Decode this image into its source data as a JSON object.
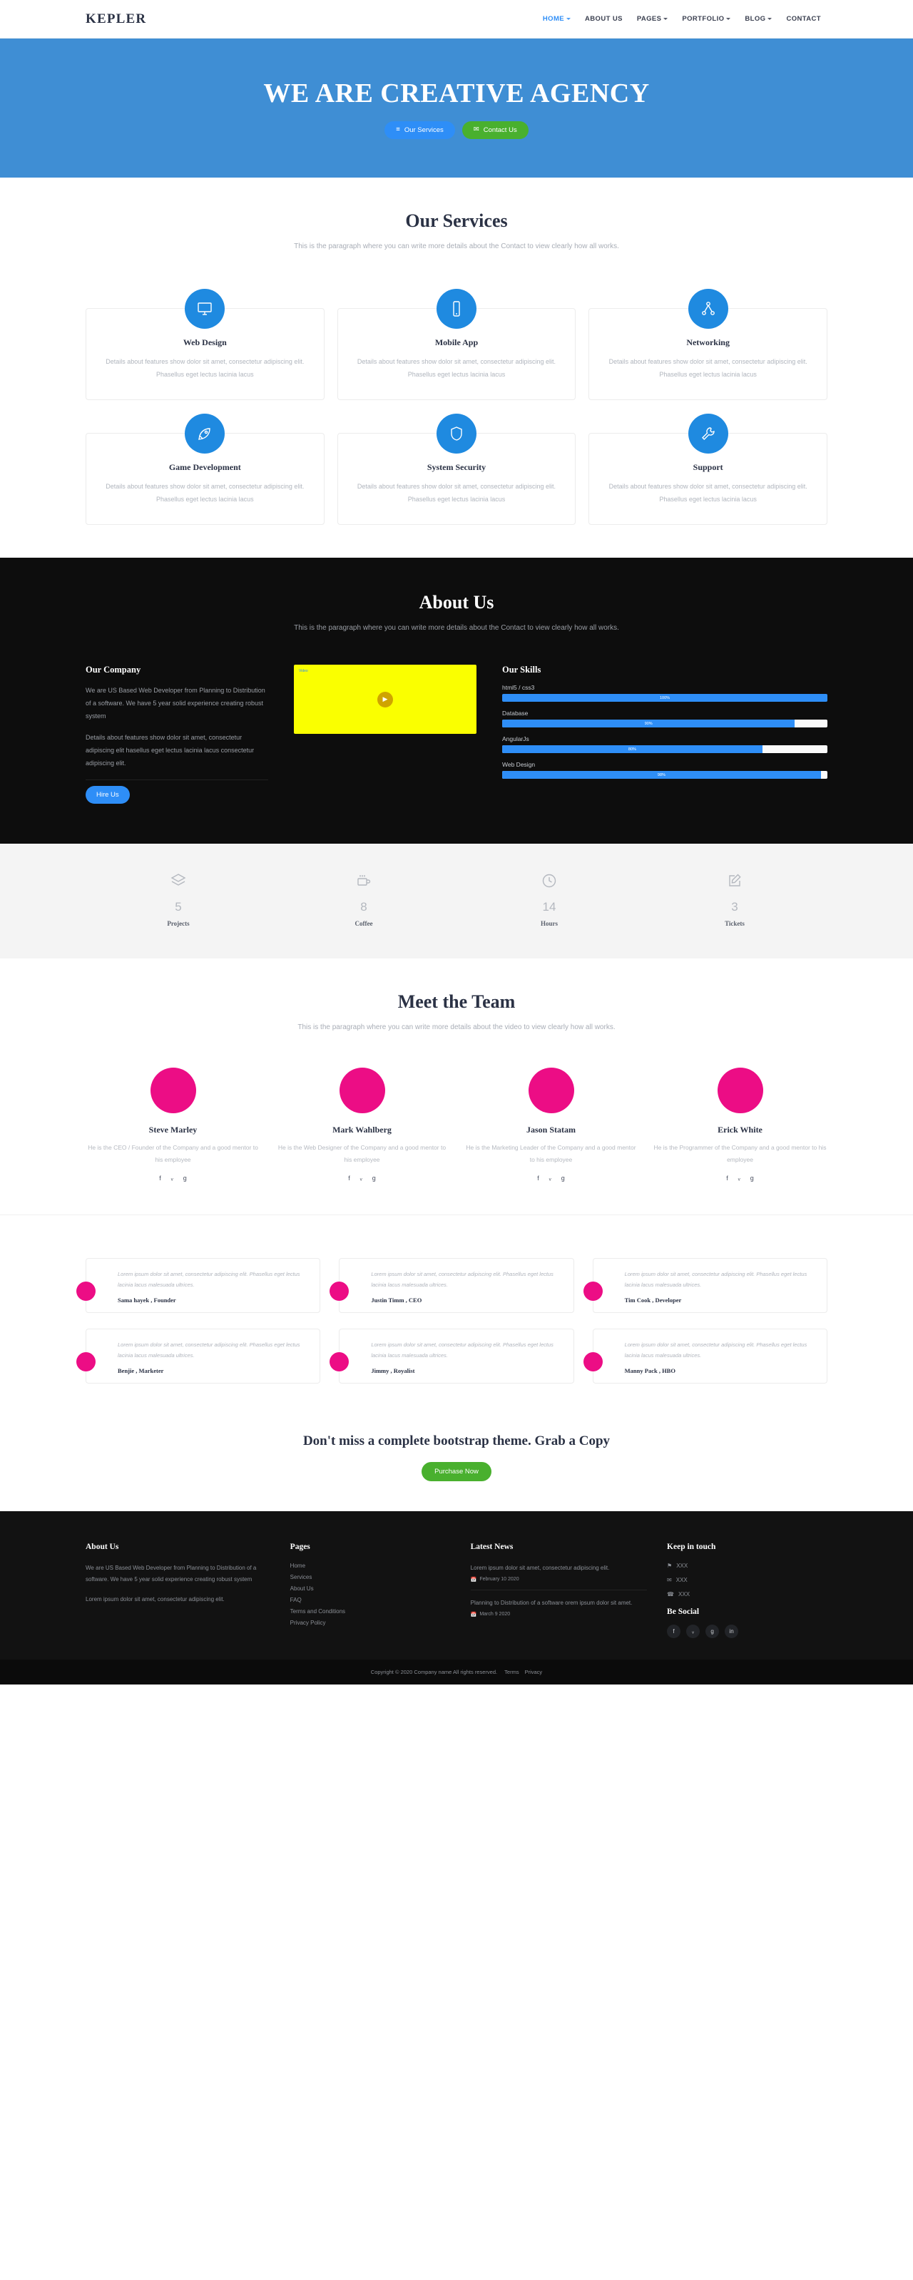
{
  "nav": {
    "brand": "KEPLER",
    "items": [
      {
        "label": "HOME",
        "caret": true,
        "active": true
      },
      {
        "label": "ABOUT US",
        "caret": false,
        "active": false
      },
      {
        "label": "PAGES",
        "caret": true,
        "active": false
      },
      {
        "label": "PORTFOLIO",
        "caret": true,
        "active": false
      },
      {
        "label": "BLOG",
        "caret": true,
        "active": false
      },
      {
        "label": "CONTACT",
        "caret": false,
        "active": false
      }
    ]
  },
  "hero": {
    "title": "WE ARE CREATIVE AGENCY",
    "bg_color": "#3f8ed4",
    "primary_button": {
      "label": "Our Services",
      "icon": "list-icon",
      "color": "#2e8ef7"
    },
    "secondary_button": {
      "label": "Contact Us",
      "icon": "envelope-icon",
      "color": "#49b02e"
    }
  },
  "services": {
    "title": "Our Services",
    "subtitle": "This is the paragraph where you can write more details about the Contact to view clearly how all works.",
    "accent_color": "#1f8ae0",
    "items": [
      {
        "icon": "monitor-icon",
        "name": "Web Design",
        "desc": "Details about features show dolor sit amet, consectetur adipiscing elit. Phasellus eget lectus lacinia lacus"
      },
      {
        "icon": "mobile-icon",
        "name": "Mobile App",
        "desc": "Details about features show dolor sit amet, consectetur adipiscing elit. Phasellus eget lectus lacinia lacus"
      },
      {
        "icon": "network-icon",
        "name": "Networking",
        "desc": "Details about features show dolor sit amet, consectetur adipiscing elit. Phasellus eget lectus lacinia lacus"
      },
      {
        "icon": "rocket-icon",
        "name": "Game Development",
        "desc": "Details about features show dolor sit amet, consectetur adipiscing elit. Phasellus eget lectus lacinia lacus"
      },
      {
        "icon": "shield-icon",
        "name": "System Security",
        "desc": "Details about features show dolor sit amet, consectetur adipiscing elit. Phasellus eget lectus lacinia lacus"
      },
      {
        "icon": "wrench-icon",
        "name": "Support",
        "desc": "Details about features show dolor sit amet, consectetur adipiscing elit. Phasellus eget lectus lacinia lacus"
      }
    ]
  },
  "about": {
    "title": "About Us",
    "subtitle": "This is the paragraph where you can write more details about the Contact to view clearly how all works.",
    "company_title": "Our Company",
    "company_p1": "We are US Based Web Developer from Planning to Distribution of a software. We have 5 year solid experience creating robust system",
    "company_p2": "Details about features show dolor sit amet, consectetur adipiscing elit hasellus eget lectus lacinia lacus consectetur adipiscing elit.",
    "hire_label": "Hire Us",
    "video_label": "Video",
    "video_bg": "#faff00",
    "skills_title": "Our Skills",
    "skills": [
      {
        "label": "html5 / css3",
        "value": 100,
        "value_text": "100%"
      },
      {
        "label": "Database",
        "value": 90,
        "value_text": "90%"
      },
      {
        "label": "AngularJs",
        "value": 80,
        "value_text": "80%"
      },
      {
        "label": "Web Design",
        "value": 98,
        "value_text": "98%"
      }
    ]
  },
  "counters": [
    {
      "icon": "layers-icon",
      "number": "5",
      "label": "Projects"
    },
    {
      "icon": "coffee-icon",
      "number": "8",
      "label": "Coffee"
    },
    {
      "icon": "clock-icon",
      "number": "14",
      "label": "Hours"
    },
    {
      "icon": "note-pencil-icon",
      "number": "3",
      "label": "Tickets"
    }
  ],
  "team": {
    "title": "Meet the Team",
    "subtitle": "This is the paragraph where you can write more details about the video to view clearly how all works.",
    "avatar_color": "#ec0d85",
    "members": [
      {
        "name": "Steve Marley",
        "role": "He is the CEO / Founder of the Company and a good mentor to his employee",
        "socials": [
          "facebook-icon",
          "twitter-icon",
          "google-plus-icon"
        ]
      },
      {
        "name": "Mark Wahlberg",
        "role": "He is the Web Designer of the Company and a good mentor to his employee",
        "socials": [
          "facebook-icon",
          "twitter-icon",
          "google-plus-icon"
        ]
      },
      {
        "name": "Jason Statam",
        "role": "He is the Marketing Leader of the Company and a good mentor to his employee",
        "socials": [
          "facebook-icon",
          "twitter-icon",
          "google-plus-icon"
        ]
      },
      {
        "name": "Erick White",
        "role": "He is the Programmer of the Company and a good mentor to his employee",
        "socials": [
          "facebook-icon",
          "twitter-icon",
          "google-plus-icon"
        ]
      }
    ]
  },
  "testimonials": {
    "avatar_color": "#ec0d85",
    "items": [
      {
        "text": "Lorem ipsum dolor sit amet, consectetur adipiscing elit. Phasellus eget lectus lacinia lacus malesuada ultrices.",
        "name": "Sama hayek , Founder"
      },
      {
        "text": "Lorem ipsum dolor sit amet, consectetur adipiscing elit. Phasellus eget lectus lacinia lacus malesuada ultrices.",
        "name": "Justin Timm , CEO"
      },
      {
        "text": "Lorem ipsum dolor sit amet, consectetur adipiscing elit. Phasellus eget lectus lacinia lacus malesuada ultrices.",
        "name": "Tim Cook , Developer"
      },
      {
        "text": "Lorem ipsum dolor sit amet, consectetur adipiscing elit. Phasellus eget lectus lacinia lacus malesuada ultrices.",
        "name": "Benjie , Marketer"
      },
      {
        "text": "Lorem ipsum dolor sit amet, consectetur adipiscing elit. Phasellus eget lectus lacinia lacus malesuada ultrices.",
        "name": "Jimmy , Royalist"
      },
      {
        "text": "Lorem ipsum dolor sit amet, consectetur adipiscing elit. Phasellus eget lectus lacinia lacus malesuada ultrices.",
        "name": "Manny Pack , HBO"
      }
    ]
  },
  "cta": {
    "heading": "Don't miss a complete bootstrap theme. Grab a Copy",
    "button_label": "Purchase Now",
    "button_color": "#49b02e"
  },
  "footer": {
    "about": {
      "title": "About Us",
      "p1": "We are US Based Web Developer from Planning to Distribution of a software. We have 5 year solid experience creating robust system",
      "p2": "Lorem ipsum dolor sit amet, consectetur adipiscing elit."
    },
    "pages": {
      "title": "Pages",
      "links": [
        "Home",
        "Services",
        "About Us",
        "FAQ",
        "Terms and Conditions",
        "Privacy Policy"
      ]
    },
    "news": {
      "title": "Latest News",
      "items": [
        {
          "text": "Lorem ipsum dolor sit amet, consectetur adipiscing elit.",
          "date": "February 10 2020",
          "icon": "calendar-icon"
        },
        {
          "text": "Planning to Distribution of a software orem ipsum dolor sit amet.",
          "date": "March 9 2020",
          "icon": "calendar-icon"
        }
      ]
    },
    "contact": {
      "title": "Keep in touch",
      "rows": [
        {
          "icon": "map-marker-icon",
          "value": "XXX"
        },
        {
          "icon": "envelope-icon",
          "value": "XXX"
        },
        {
          "icon": "phone-icon",
          "value": "XXX"
        }
      ],
      "social_title": "Be Social",
      "socials": [
        "facebook-icon",
        "twitter-icon",
        "google-plus-icon",
        "linkedin-icon"
      ]
    },
    "copyright": "Copyright © 2020 Company name All rights reserved.",
    "copyright_links": [
      "Terms",
      "Privacy"
    ]
  }
}
